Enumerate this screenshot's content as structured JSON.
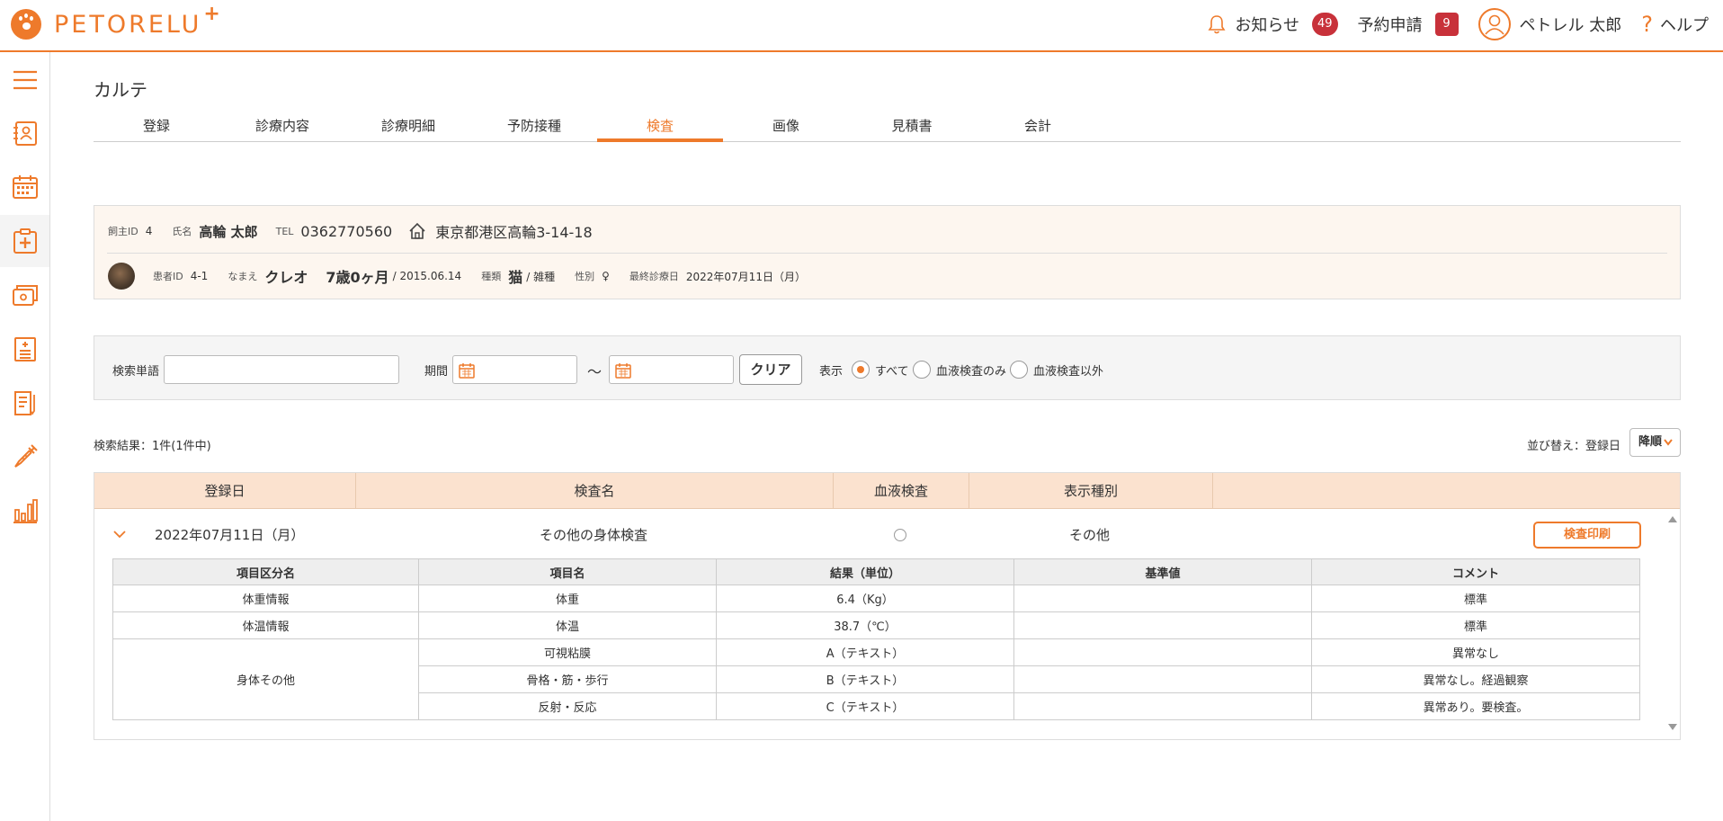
{
  "header": {
    "brand": "PETORELU",
    "brand_plus": "+",
    "notifications_label": "お知らせ",
    "notifications_count": "49",
    "reservations_label": "予約申請",
    "reservations_count": "9",
    "user_name": "ペトレル 太郎",
    "help_label": "ヘルプ"
  },
  "sidebar": {
    "items": [
      "menu-icon",
      "owner-card-icon",
      "calendar-icon",
      "medical-record-icon",
      "payment-icon",
      "pharmacy-icon",
      "document-icon",
      "vaccine-icon",
      "stats-icon"
    ],
    "active_index": 3
  },
  "page": {
    "title": "カルテ"
  },
  "tabs": [
    {
      "label": "登録",
      "active": false
    },
    {
      "label": "診療内容",
      "active": false
    },
    {
      "label": "診療明細",
      "active": false
    },
    {
      "label": "予防接種",
      "active": false
    },
    {
      "label": "検査",
      "active": true
    },
    {
      "label": "画像",
      "active": false
    },
    {
      "label": "見積書",
      "active": false
    },
    {
      "label": "会計",
      "active": false
    }
  ],
  "owner": {
    "id_label": "飼主ID",
    "id": "4",
    "name_label": "氏名",
    "name": "高輪 太郎",
    "tel_label": "TEL",
    "tel": "0362770560",
    "address": "東京都港区高輪3-14-18"
  },
  "pet": {
    "id_label": "患者ID",
    "id": "4-1",
    "name_label": "なまえ",
    "name": "クレオ",
    "age": "7歳0ヶ月",
    "birth": "/ 2015.06.14",
    "species_label": "種類",
    "species": "猫",
    "breed": "/ 雑種",
    "sex_label": "性別",
    "sex": "♀",
    "last_visit_label": "最終診療日",
    "last_visit": "2022年07月11日（月）"
  },
  "search": {
    "keyword_label": "検索単語",
    "keyword_value": "",
    "period_label": "期間",
    "tilde": "～",
    "clear_label": "クリア",
    "display_label": "表示",
    "options": [
      {
        "label": "すべて",
        "selected": true
      },
      {
        "label": "血液検査のみ",
        "selected": false
      },
      {
        "label": "血液検査以外",
        "selected": false
      }
    ]
  },
  "results": {
    "count_text": "検索結果：1件(1件中)",
    "sort_label": "並び替え：登録日",
    "sort_value": "降順",
    "columns": [
      "登録日",
      "検査名",
      "血液検査",
      "表示種別"
    ],
    "record": {
      "date": "2022年07月11日（月）",
      "exam_name": "その他の身体検査",
      "blood_test": "○",
      "display_type": "その他",
      "print_label": "検査印刷"
    },
    "detail_columns": [
      "項目区分名",
      "項目名",
      "結果（単位）",
      "基準値",
      "コメント"
    ],
    "detail_rows": [
      {
        "category": "体重情報",
        "item": "体重",
        "result": "6.4（Kg）",
        "reference": "",
        "comment": "標準"
      },
      {
        "category": "体温情報",
        "item": "体温",
        "result": "38.7（℃）",
        "reference": "",
        "comment": "標準"
      },
      {
        "category": "身体その他",
        "item": "可視粘膜",
        "result": "A（テキスト）",
        "reference": "",
        "comment": "異常なし"
      },
      {
        "category": "",
        "item": "骨格・筋・歩行",
        "result": "B（テキスト）",
        "reference": "",
        "comment": "異常なし。経過観察"
      },
      {
        "category": "",
        "item": "反射・反応",
        "result": "C（テキスト）",
        "reference": "",
        "comment": "異常あり。要検査。"
      }
    ]
  },
  "colors": {
    "accent": "#ee7a2b",
    "badge": "#c8313a",
    "header_row": "#fbe2cf",
    "info_bg": "#fdf6ef"
  }
}
